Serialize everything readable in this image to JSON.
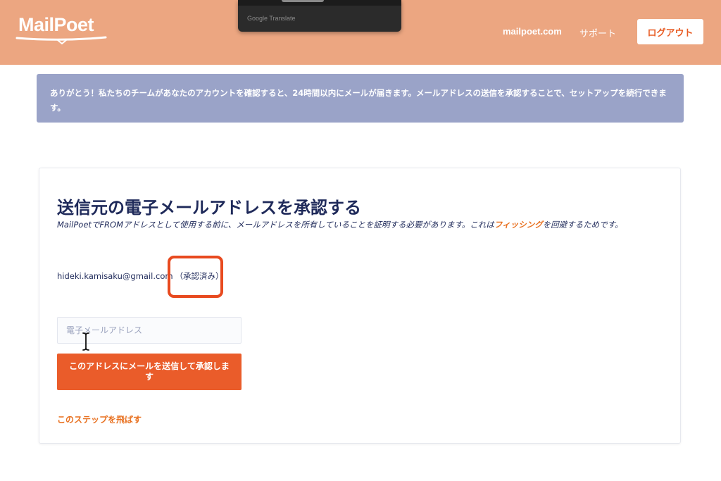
{
  "header": {
    "logo_text": "MailPoet",
    "nav": {
      "site_link": "mailpoet.com",
      "support_link": "サポート"
    },
    "logout_label": "ログアウト"
  },
  "translate_popup": {
    "caption": "Google Translate"
  },
  "notice": {
    "text": "ありがとう！私たちのチームがあなたのアカウントを確認すると、24時間以内にメールが届きます。メールアドレスの送信を承認することで、セットアップを続行できます。"
  },
  "card": {
    "title": "送信元の電子メールアドレスを承認する",
    "description_before": "MailPoetでFROMアドレスとして使用する前に、メールアドレスを所有していることを証明する必要があります。これは",
    "phishing_link": "フィッシング",
    "description_after": "を回避するためです。",
    "verified_email": "hideki.kamisaku@gmail.com",
    "verified_status": "（承認済み）",
    "email_input": {
      "value": "",
      "placeholder": "電子メールアドレス"
    },
    "send_button_label": "このアドレスにメールを送信して承認します",
    "skip_link": "このステップを飛ばす"
  },
  "colors": {
    "header_bg": "#eca681",
    "notice_bg": "#9aa3c8",
    "primary_button": "#ea5c2a",
    "link_orange": "#e8701f",
    "highlight_red": "#e84a1f",
    "text_navy": "#1f2a5a"
  },
  "icons": {
    "logo_underline": "logo-swoosh-icon",
    "mouse_cursor": "text-cursor-icon"
  }
}
